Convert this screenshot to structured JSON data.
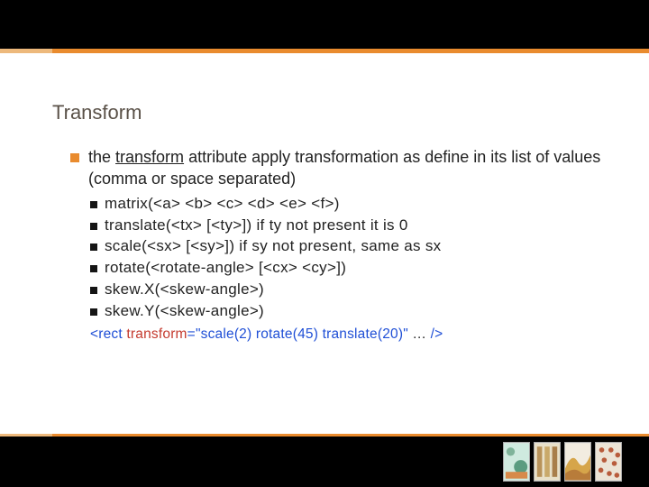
{
  "heading": "Transform",
  "main_bullet": {
    "prefix": "the ",
    "underlined": "transform",
    "suffix": " attribute apply transformation as define in its list of values (comma or space separated)"
  },
  "sub_bullets": [
    "matrix(<a> <b> <c> <d> <e> <f>)",
    "translate(<tx> [<ty>]) if ty not present it is 0",
    "scale(<sx> [<sy>]) if sy not present, same as sx",
    "rotate(<rotate-angle> [<cx> <cy>])",
    "skew.X(<skew-angle>)",
    "skew.Y(<skew-angle>)"
  ],
  "code": {
    "p1": "<rect ",
    "attr": "transform",
    "eq": "=",
    "val": "\"scale(2) rotate(45) translate(20)\"",
    "p2": " … ",
    "p3": "/>"
  }
}
